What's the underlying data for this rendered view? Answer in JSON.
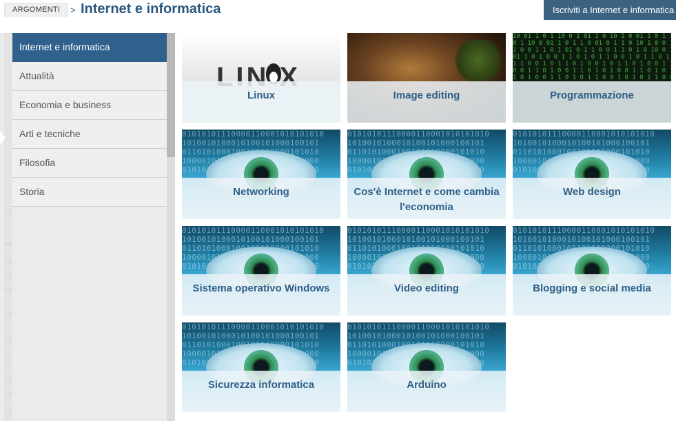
{
  "header": {
    "breadcrumb_root": "ARGOMENTI",
    "breadcrumb_separator": ">",
    "title": "Internet e informatica",
    "subscribe_button": "Iscriviti a Internet e informatica"
  },
  "sidebar": {
    "items": [
      {
        "label": "Internet e informatica",
        "active": true
      },
      {
        "label": "Attualità",
        "active": false
      },
      {
        "label": "Economia e business",
        "active": false
      },
      {
        "label": "Arti e tecniche",
        "active": false
      },
      {
        "label": "Filosofia",
        "active": false
      },
      {
        "label": "Storia",
        "active": false
      }
    ]
  },
  "tiles": [
    {
      "label": "Linux",
      "image": "linux-logo"
    },
    {
      "label": "Image editing",
      "image": "deer-photo"
    },
    {
      "label": "Programmazione",
      "image": "green-code"
    },
    {
      "label": "Networking",
      "image": "binary-eye"
    },
    {
      "label": "Cos'è Internet e come cambia l'economia",
      "image": "binary-eye"
    },
    {
      "label": "Web design",
      "image": "binary-eye"
    },
    {
      "label": "Sistema operativo Windows",
      "image": "binary-eye"
    },
    {
      "label": "Video editing",
      "image": "binary-eye"
    },
    {
      "label": "Blogging e social media",
      "image": "binary-eye"
    },
    {
      "label": "Sicurezza informatica",
      "image": "binary-eye"
    },
    {
      "label": "Arduino",
      "image": "binary-eye"
    }
  ],
  "colors": {
    "accent": "#30618d",
    "title": "#2b587f",
    "tile_label": "#2e5f86",
    "subscribe_bg": "#3c6282"
  }
}
